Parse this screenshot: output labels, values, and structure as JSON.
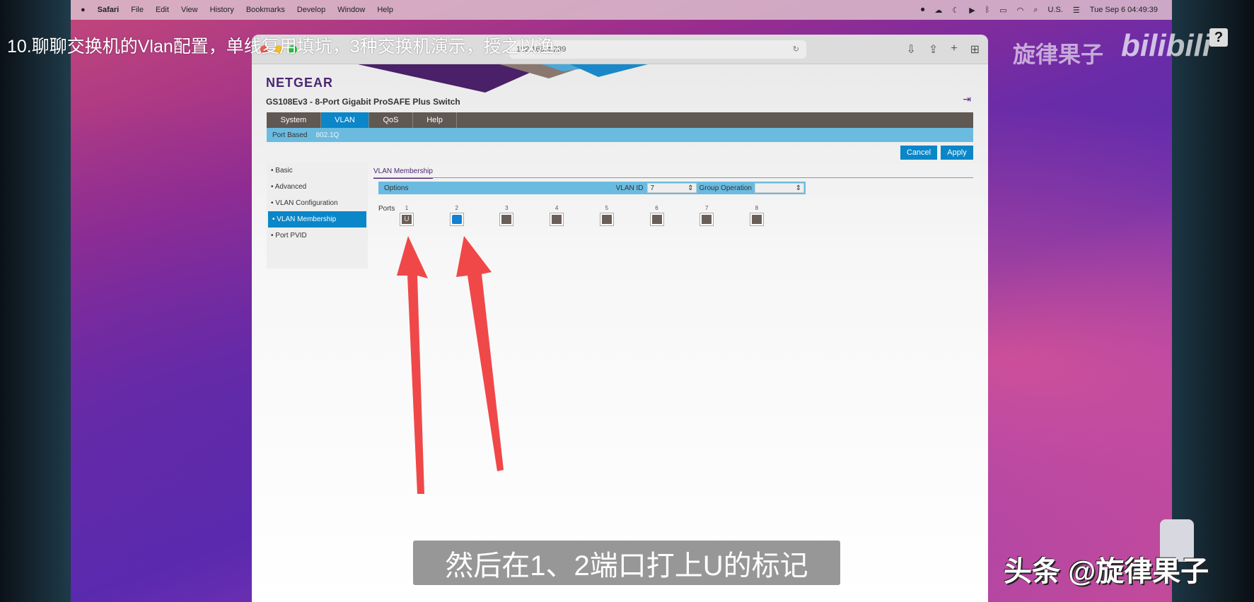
{
  "video_title": "10.聊聊交换机的Vlan配置，单线复用填坑，3种交换机演示，授之以渔。",
  "subtitle": "然后在1、2端口打上U的标记",
  "watermark_bottom": "头条 @旋律果子",
  "watermark_top": "旋律果子",
  "bilibili_logo": "bilibili",
  "help_badge": "?",
  "menubar": {
    "app": "Safari",
    "items": [
      "File",
      "Edit",
      "View",
      "History",
      "Bookmarks",
      "Develop",
      "Window",
      "Help"
    ],
    "input_source": "U.S.",
    "clock": "Tue Sep 6  04:49:39"
  },
  "browser": {
    "url": "192.168.4.239"
  },
  "netgear": {
    "logo": "NETGEAR",
    "model": "GS108Ev3 - 8-Port Gigabit ProSAFE Plus Switch",
    "nav": [
      "System",
      "VLAN",
      "QoS",
      "Help"
    ],
    "subnav": [
      "Port Based",
      "802.1Q"
    ],
    "cancel": "Cancel",
    "apply": "Apply",
    "sidebar": [
      "• Basic",
      "• Advanced",
      "• VLAN Configuration",
      "• VLAN Membership",
      "• Port PVID"
    ],
    "tab": "VLAN Membership",
    "options_label": "Options",
    "vlan_id_label": "VLAN ID",
    "vlan_id": "7",
    "group_op_label": "Group Operation",
    "group_op": "",
    "ports_label": "Ports",
    "ports": [
      {
        "n": "1",
        "mark": "U"
      },
      {
        "n": "2",
        "mark": ""
      },
      {
        "n": "3",
        "mark": ""
      },
      {
        "n": "4",
        "mark": ""
      },
      {
        "n": "5",
        "mark": ""
      },
      {
        "n": "6",
        "mark": ""
      },
      {
        "n": "7",
        "mark": ""
      },
      {
        "n": "8",
        "mark": ""
      }
    ]
  },
  "colors": {
    "accent": "#0a86c9",
    "nav": "#605852",
    "subnav": "#6bbbe0",
    "arrow": "#f04848"
  }
}
